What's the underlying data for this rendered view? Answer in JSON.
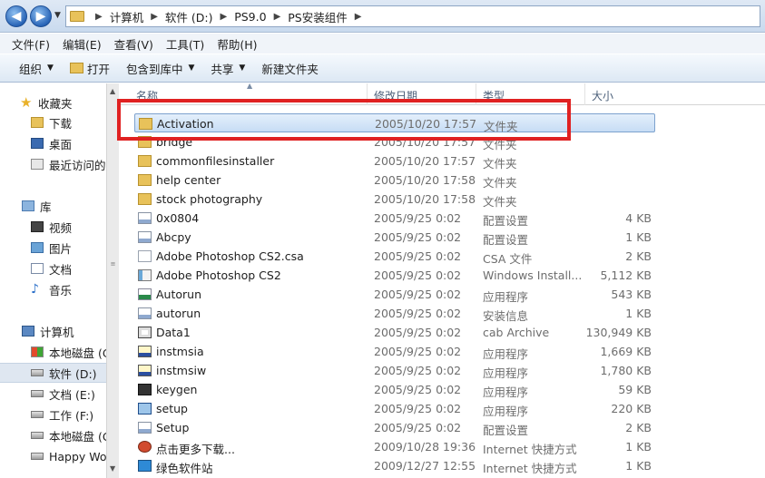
{
  "address": {
    "back_icon": "back-arrow-icon",
    "forward_icon": "forward-arrow-icon",
    "breadcrumbs": [
      "计算机",
      "软件 (D:)",
      "PS9.0",
      "PS安装组件"
    ]
  },
  "menu": {
    "items": [
      "文件(F)",
      "编辑(E)",
      "查看(V)",
      "工具(T)",
      "帮助(H)"
    ]
  },
  "toolbar": {
    "organize": "组织",
    "open": "打开",
    "include_in_library": "包含到库中",
    "share": "共享",
    "new_folder": "新建文件夹"
  },
  "sidebar": {
    "favorites": "收藏夹",
    "downloads": "下载",
    "desktop": "桌面",
    "recent": "最近访问的",
    "libraries": "库",
    "videos": "视频",
    "pictures": "图片",
    "documents": "文档",
    "music": "音乐",
    "computer": "计算机",
    "drives": [
      "本地磁盘 (C",
      "软件 (D:)",
      "文档 (E:)",
      "工作 (F:)",
      "本地磁盘 (G",
      "Happy Wo"
    ]
  },
  "columns": {
    "name": "名称",
    "date": "修改日期",
    "type": "类型",
    "size": "大小"
  },
  "files": [
    {
      "name": "Activation",
      "date": "2005/10/20 17:57",
      "type": "文件夹",
      "size": "",
      "icon": "folder"
    },
    {
      "name": "bridge",
      "date": "2005/10/20 17:57",
      "type": "文件夹",
      "size": "",
      "icon": "folder"
    },
    {
      "name": "commonfilesinstaller",
      "date": "2005/10/20 17:57",
      "type": "文件夹",
      "size": "",
      "icon": "folder"
    },
    {
      "name": "help center",
      "date": "2005/10/20 17:58",
      "type": "文件夹",
      "size": "",
      "icon": "folder"
    },
    {
      "name": "stock photography",
      "date": "2005/10/20 17:58",
      "type": "文件夹",
      "size": "",
      "icon": "folder"
    },
    {
      "name": "0x0804",
      "date": "2005/9/25 0:02",
      "type": "配置设置",
      "size": "4 KB",
      "icon": "ini"
    },
    {
      "name": "Abcpy",
      "date": "2005/9/25 0:02",
      "type": "配置设置",
      "size": "1 KB",
      "icon": "ini"
    },
    {
      "name": "Adobe Photoshop CS2.csa",
      "date": "2005/9/25 0:02",
      "type": "CSA 文件",
      "size": "2 KB",
      "icon": "file"
    },
    {
      "name": "Adobe Photoshop CS2",
      "date": "2005/9/25 0:02",
      "type": "Windows Install...",
      "size": "5,112 KB",
      "icon": "msi"
    },
    {
      "name": "Autorun",
      "date": "2005/9/25 0:02",
      "type": "应用程序",
      "size": "543 KB",
      "icon": "autorun"
    },
    {
      "name": "autorun",
      "date": "2005/9/25 0:02",
      "type": "安装信息",
      "size": "1 KB",
      "icon": "ini"
    },
    {
      "name": "Data1",
      "date": "2005/9/25 0:02",
      "type": "cab Archive",
      "size": "130,949 KB",
      "icon": "cab"
    },
    {
      "name": "instmsia",
      "date": "2005/9/25 0:02",
      "type": "应用程序",
      "size": "1,669 KB",
      "icon": "inst"
    },
    {
      "name": "instmsiw",
      "date": "2005/9/25 0:02",
      "type": "应用程序",
      "size": "1,780 KB",
      "icon": "inst"
    },
    {
      "name": "keygen",
      "date": "2005/9/25 0:02",
      "type": "应用程序",
      "size": "59 KB",
      "icon": "keygen"
    },
    {
      "name": "setup",
      "date": "2005/9/25 0:02",
      "type": "应用程序",
      "size": "220 KB",
      "icon": "setup"
    },
    {
      "name": "Setup",
      "date": "2005/9/25 0:02",
      "type": "配置设置",
      "size": "2 KB",
      "icon": "ini"
    },
    {
      "name": "点击更多下载...",
      "date": "2009/10/28 19:36",
      "type": "Internet 快捷方式",
      "size": "1 KB",
      "icon": "link"
    },
    {
      "name": "绿色软件站",
      "date": "2009/12/27 12:55",
      "type": "Internet 快捷方式",
      "size": "1 KB",
      "icon": "link2"
    }
  ],
  "selected_index": 0,
  "highlight_color": "#e02121"
}
